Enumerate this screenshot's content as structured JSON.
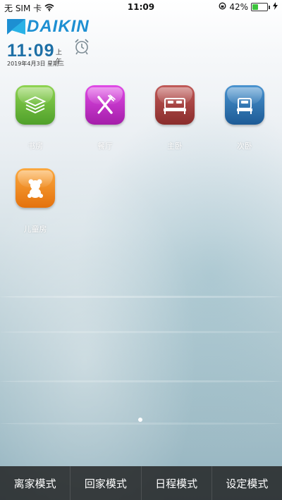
{
  "status_bar": {
    "carrier": "无 SIM 卡",
    "time": "11:09",
    "battery": "42%",
    "battery_level": 0.42
  },
  "brand": {
    "name": "DAIKIN"
  },
  "clock": {
    "time": "11:09",
    "ampm": "上午",
    "date": "2019年4月3日 星期三"
  },
  "rooms": [
    {
      "label": "书房",
      "icon": "books-icon",
      "color": "#6fbf3a"
    },
    {
      "label": "餐厅",
      "icon": "fork-knife-icon",
      "color": "#c32fc9"
    },
    {
      "label": "主卧",
      "icon": "double-bed-icon",
      "color": "#a5403f"
    },
    {
      "label": "次卧",
      "icon": "single-bed-icon",
      "color": "#2d76b5"
    },
    {
      "label": "儿童房",
      "icon": "teddy-bear-icon",
      "color": "#f08a1c"
    }
  ],
  "modes": [
    {
      "label": "离家模式"
    },
    {
      "label": "回家模式"
    },
    {
      "label": "日程模式"
    },
    {
      "label": "设定模式"
    }
  ]
}
